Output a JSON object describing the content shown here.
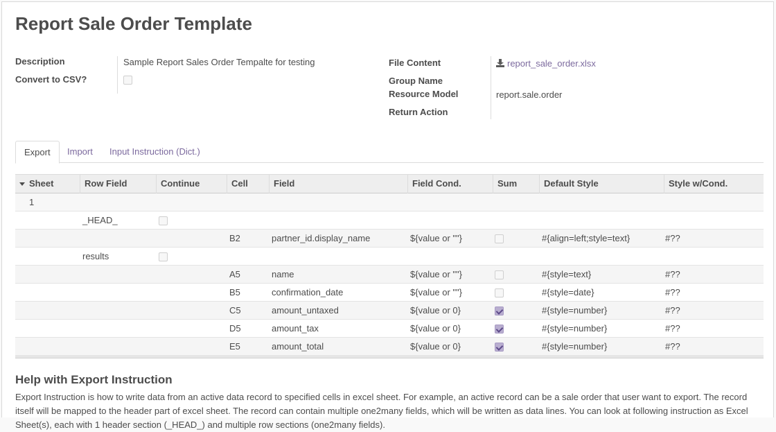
{
  "page": {
    "title": "Report Sale Order Template"
  },
  "form": {
    "description_label": "Description",
    "description_value": "Sample Report Sales Order Tempalte for testing",
    "convert_csv_label": "Convert to CSV?",
    "convert_csv_checked": false,
    "file_content_label": "File Content",
    "file_name": "report_sale_order.xlsx",
    "group_name_label": "Group Name",
    "group_name_value": "",
    "resource_model_label": "Resource Model",
    "resource_model_value": "report.sale.order",
    "return_action_label": "Return Action",
    "return_action_value": ""
  },
  "tabs": [
    {
      "label": "Export",
      "active": true
    },
    {
      "label": "Import",
      "active": false
    },
    {
      "label": "Input Instruction (Dict.)",
      "active": false
    }
  ],
  "grid": {
    "columns": [
      "Sheet",
      "Row Field",
      "Continue",
      "Cell",
      "Field",
      "Field Cond.",
      "Sum",
      "Default Style",
      "Style w/Cond."
    ],
    "rows": [
      {
        "kind": "group",
        "sheet": "1"
      },
      {
        "sheet": "",
        "row_field": "_HEAD_",
        "continue": false,
        "cell": "",
        "field": "",
        "field_cond": "",
        "sum": null,
        "default_style": "",
        "style_cond": ""
      },
      {
        "sheet": "",
        "row_field": "",
        "continue": null,
        "cell": "B2",
        "field": "partner_id.display_name",
        "field_cond": "${value or \"\"}",
        "sum": false,
        "default_style": "#{align=left;style=text}",
        "style_cond": "#??"
      },
      {
        "sheet": "",
        "row_field": "results",
        "continue": false,
        "cell": "",
        "field": "",
        "field_cond": "",
        "sum": null,
        "default_style": "",
        "style_cond": ""
      },
      {
        "sheet": "",
        "row_field": "",
        "continue": null,
        "cell": "A5",
        "field": "name",
        "field_cond": "${value or \"\"}",
        "sum": false,
        "default_style": "#{style=text}",
        "style_cond": "#??"
      },
      {
        "sheet": "",
        "row_field": "",
        "continue": null,
        "cell": "B5",
        "field": "confirmation_date",
        "field_cond": "${value or \"\"}",
        "sum": false,
        "default_style": "#{style=date}",
        "style_cond": "#??"
      },
      {
        "sheet": "",
        "row_field": "",
        "continue": null,
        "cell": "C5",
        "field": "amount_untaxed",
        "field_cond": "${value or 0}",
        "sum": true,
        "default_style": "#{style=number}",
        "style_cond": "#??"
      },
      {
        "sheet": "",
        "row_field": "",
        "continue": null,
        "cell": "D5",
        "field": "amount_tax",
        "field_cond": "${value or 0}",
        "sum": true,
        "default_style": "#{style=number}",
        "style_cond": "#??"
      },
      {
        "sheet": "",
        "row_field": "",
        "continue": null,
        "cell": "E5",
        "field": "amount_total",
        "field_cond": "${value or 0}",
        "sum": true,
        "default_style": "#{style=number}",
        "style_cond": "#??"
      }
    ]
  },
  "help": {
    "title": "Help with Export Instruction",
    "text": "Export Instruction is how to write data from an active data record to specified cells in excel sheet. For example, an active record can be a sale order that user want to export. The record itself will be mapped to the header part of excel sheet. The record can contain multiple one2many fields, which will be written as data lines. You can look at following instruction as Excel Sheet(s), each with 1 header section (_HEAD_) and multiple row sections (one2many fields)."
  },
  "colors": {
    "link": "#7c6a9e",
    "text": "#4c4c4c",
    "checked": "#b9aed0"
  }
}
